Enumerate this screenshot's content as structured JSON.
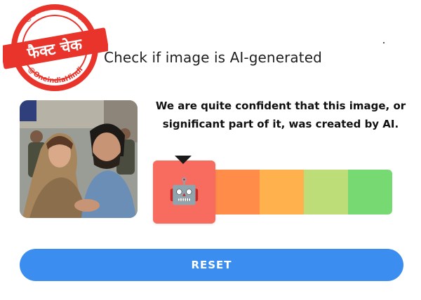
{
  "stamp": {
    "handle_top": "@OneindiaHindi",
    "handle_bottom": "@OneindiaHindi",
    "word": "फैक्ट चेक",
    "color": "#e8342b"
  },
  "header": {
    "title": "Check if image is AI-generated"
  },
  "photo": {
    "icon": "analyzed-photo"
  },
  "result": {
    "verdict_line1": "We are quite confident that this image, or",
    "verdict_line2": "significant part of it, was created by AI."
  },
  "meter": {
    "segments": [
      "#f86c5f",
      "#ff8c48",
      "#ffb14e",
      "#bddd79",
      "#77d971"
    ],
    "active_index": 0,
    "active_color": "#f86c5f",
    "active_icon": "robot-icon",
    "active_emoji": "🤖"
  },
  "actions": {
    "reset_label": "RESET",
    "reset_color": "#3b8df0"
  }
}
